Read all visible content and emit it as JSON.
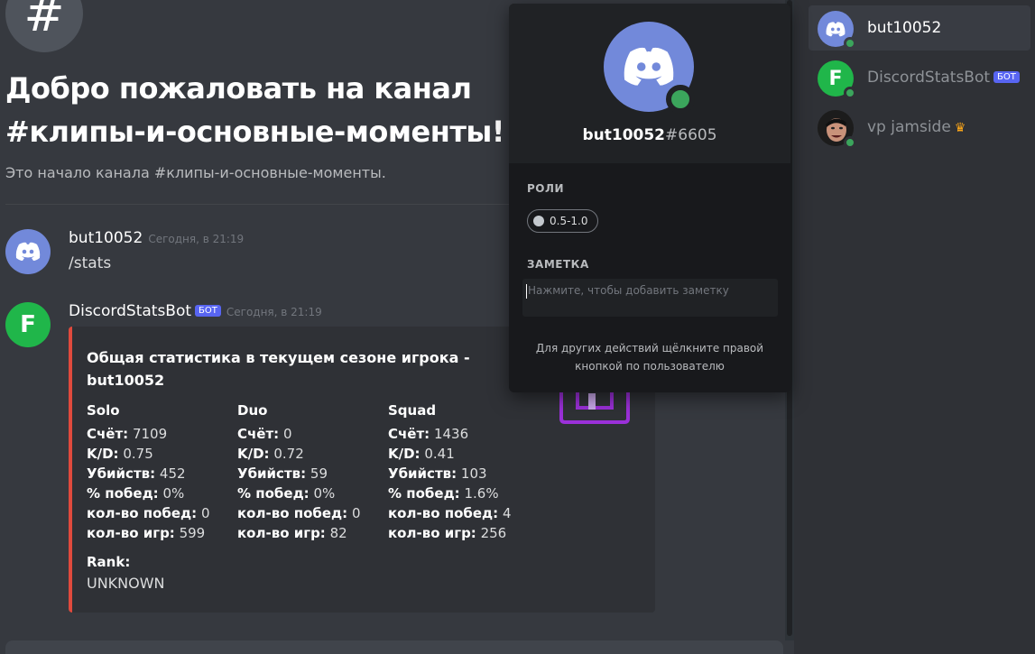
{
  "channel": {
    "hash_symbol": "#",
    "welcome_title": "Добро пожаловать на канал #клипы-и-основные-моменты!",
    "welcome_subtitle": "Это начало канала #клипы-и-основные-моменты."
  },
  "messages": [
    {
      "author": "but10052",
      "timestamp": "Сегодня, в 21:19",
      "text": "/stats",
      "avatar_icon": "discord-logo-icon"
    },
    {
      "author": "DiscordStatsBot",
      "bot_tag": "БОТ",
      "timestamp": "Сегодня, в 21:19",
      "avatar_letter": "F",
      "avatar_icon": "fortnite-f-icon"
    }
  ],
  "embed": {
    "accent_color": "#e04a3d",
    "title": "Общая статистика в текущем сезоне игрока - but10052",
    "columns": [
      {
        "title": "Solo",
        "rows": [
          {
            "label": "Счёт:",
            "value": "7109"
          },
          {
            "label": "K/D:",
            "value": "0.75"
          },
          {
            "label": "Убийств:",
            "value": "452"
          },
          {
            "label": "% побед:",
            "value": "0%"
          },
          {
            "label": "кол-во побед:",
            "value": "0"
          },
          {
            "label": "кол-во игр:",
            "value": "599"
          }
        ]
      },
      {
        "title": "Duo",
        "rows": [
          {
            "label": "Счёт:",
            "value": "0"
          },
          {
            "label": "K/D:",
            "value": "0.72"
          },
          {
            "label": "Убийств:",
            "value": "59"
          },
          {
            "label": "% побед:",
            "value": "0%"
          },
          {
            "label": "кол-во побед:",
            "value": "0"
          },
          {
            "label": "кол-во игр:",
            "value": "82"
          }
        ]
      },
      {
        "title": "Squad",
        "rows": [
          {
            "label": "Счёт:",
            "value": "1436"
          },
          {
            "label": "K/D:",
            "value": "0.41"
          },
          {
            "label": "Убийств:",
            "value": "103"
          },
          {
            "label": "% побед:",
            "value": "1.6%"
          },
          {
            "label": "кол-во побед:",
            "value": "4"
          },
          {
            "label": "кол-во игр:",
            "value": "256"
          }
        ]
      }
    ],
    "rank_label": "Rank:",
    "rank_value": "UNKNOWN"
  },
  "popout": {
    "username": "but10052",
    "discriminator": "#6605",
    "roles_heading": "РОЛИ",
    "role": "0.5-1.0",
    "note_heading": "ЗАМЕТКА",
    "note_placeholder": "Нажмите, чтобы добавить заметку",
    "hint": "Для других действий щёлкните правой кнопкой по пользователю"
  },
  "members": [
    {
      "name": "but10052",
      "selected": true,
      "status": "online"
    },
    {
      "name": "DiscordStatsBot",
      "bot_tag": "БОТ",
      "status": "online"
    },
    {
      "name": "vp jamside",
      "status": "online",
      "crown": "♛"
    }
  ],
  "colors": {
    "blurple": "#7289da",
    "online": "#3ba55c",
    "bot_green": "#20b64a",
    "bot_tag": "#5865f2"
  }
}
